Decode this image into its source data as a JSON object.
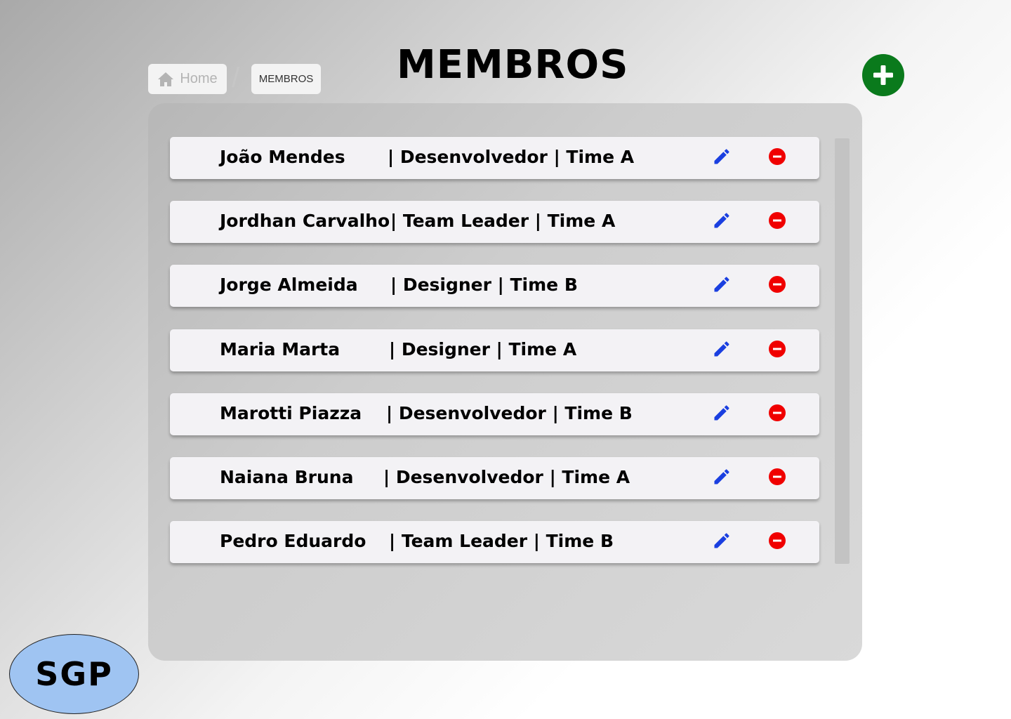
{
  "header": {
    "title": "MEMBROS"
  },
  "breadcrumb": {
    "home_label": "Home",
    "separator": "/",
    "current_label": "MEMBROS"
  },
  "actions": {
    "add_icon": "plus-icon",
    "add_color": "#0a7a1c"
  },
  "members": [
    {
      "name": "João Mendes",
      "info": "| Desenvolvedor | Time A"
    },
    {
      "name": "Jordhan Carvalho",
      "info": "| Team Leader | Time A"
    },
    {
      "name": "Jorge Almeida",
      "info": "| Designer | Time B"
    },
    {
      "name": "Maria Marta",
      "info": "| Designer | Time A"
    },
    {
      "name": "Marotti Piazza",
      "info": "| Desenvolvedor | Time B"
    },
    {
      "name": "Naiana Bruna",
      "info": "| Desenvolvedor | Time A"
    },
    {
      "name": "Pedro Eduardo",
      "info": "| Team Leader | Time B"
    }
  ],
  "row_icons": {
    "edit_icon": "pencil-icon",
    "edit_color": "#1a3fe0",
    "remove_icon": "minus-circle-icon",
    "remove_color": "#f00000"
  },
  "logo": {
    "text": "SGP"
  }
}
